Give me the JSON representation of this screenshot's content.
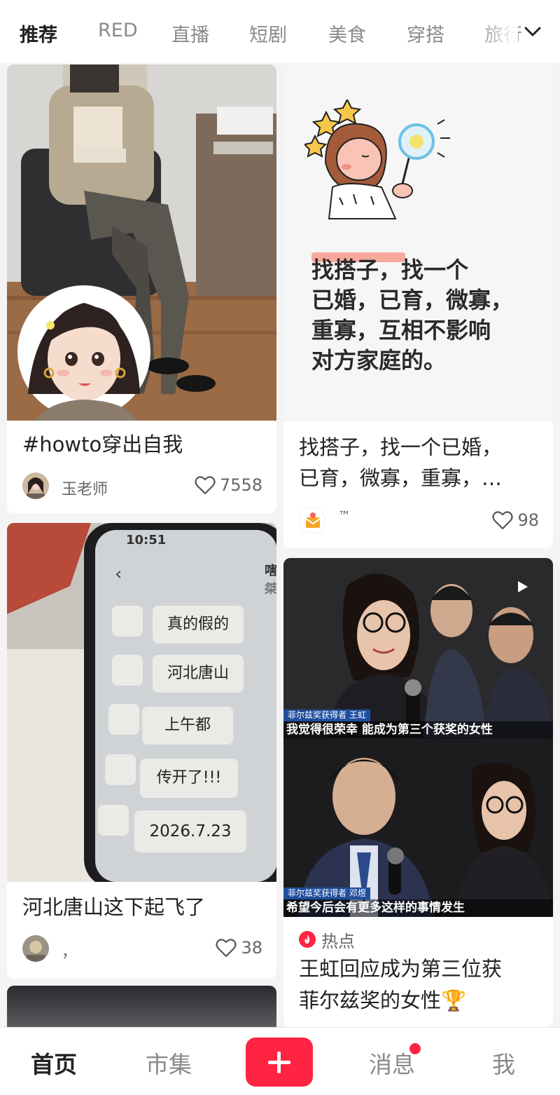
{
  "top_tabs": [
    "推荐",
    "RED",
    "直播",
    "短剧",
    "美食",
    "穿搭",
    "旅行"
  ],
  "feed": {
    "card1": {
      "caption": "#howto穿出自我",
      "author": "玉老师",
      "likes": "7558"
    },
    "card2": {
      "poster_lines": [
        "找搭子，找一个",
        "已婚，已育，微寡，",
        "重寡，互相不影响",
        "对方家庭的。"
      ],
      "caption_lines": [
        "找搭子，找一个已婚，",
        "已育，微寡，重寡，…"
      ],
      "author": "™",
      "likes": "98"
    },
    "card3": {
      "phone_time": "10:51",
      "chat_bubbles": [
        "真的假的",
        "河北唐山",
        "上午都",
        "传开了!!!",
        "2026.7.23"
      ],
      "side_text": [
        "嗐",
        "桀"
      ],
      "caption": "河北唐山这下起飞了",
      "author": "，",
      "likes": "38"
    },
    "card4": {
      "news_top_label": "菲尔兹奖获得者 王虹",
      "news_top_sub": "我觉得很荣幸 能成为第三个获奖的女性",
      "news_bot_label": "菲尔兹奖获得者 邓煜",
      "news_bot_sub": "希望今后会有更多这样的事情发生",
      "hot_tag": "热点",
      "title_lines": [
        "王虹回应成为第三位获",
        "菲尔兹奖的女性🏆"
      ]
    }
  },
  "bottom_nav": {
    "home": "首页",
    "market": "市集",
    "messages": "消息",
    "me": "我"
  },
  "colors": {
    "accent": "#ff2442",
    "highlight": "#f7a99c"
  },
  "icons": [
    "chevron-down-icon",
    "heart-icon",
    "video-play-icon",
    "fire-icon",
    "plus-icon"
  ]
}
